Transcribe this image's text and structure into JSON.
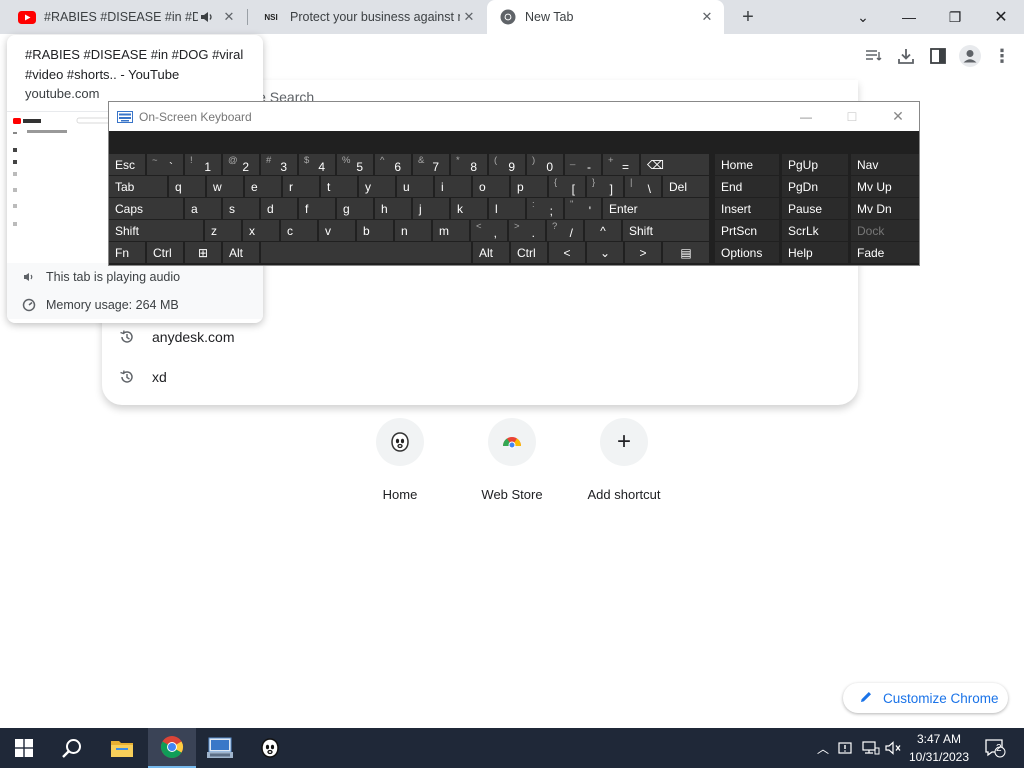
{
  "browser": {
    "tabs": [
      {
        "title": "#RABIES #DISEASE #in #DOG",
        "icon": "youtube-icon",
        "audio_icon": "speaker-icon"
      },
      {
        "title": "Protect your business against ne",
        "icon": "nsi-favicon",
        "favicon_text": "NSI"
      },
      {
        "title": "New Tab",
        "icon": "chrome-icon"
      }
    ],
    "new_tab_label": "+",
    "window_controls": {
      "tab_search": "⌄",
      "minimize": "—",
      "maximize": "❐",
      "close": "✕"
    }
  },
  "hover_card": {
    "title": "#RABIES #DISEASE #in #DOG #viral #video #shorts.. - YouTube",
    "domain": "youtube.com",
    "audio_status": "This tab is playing audio",
    "memory_usage": "Memory usage: 264 MB"
  },
  "new_tab_page": {
    "search_partial": "le Search",
    "history": [
      {
        "text": "anydesk.com",
        "icon": "history-icon"
      },
      {
        "text": "xd",
        "icon": "history-icon"
      }
    ],
    "shortcuts": [
      {
        "label": "Home",
        "icon": "ghost-face-icon"
      },
      {
        "label": "Web Store",
        "icon": "chrome-web-store-icon"
      },
      {
        "label": "Add shortcut",
        "icon": "plus-icon",
        "glyph": "+"
      }
    ],
    "customize_label": "Customize Chrome"
  },
  "osk": {
    "title": "On-Screen Keyboard",
    "controls": {
      "minimize": "—",
      "maximize": "☐",
      "close": "✕"
    },
    "rows": [
      [
        {
          "m": "Esc"
        },
        {
          "s": "~",
          "m": "`"
        },
        {
          "s": "!",
          "m": "1"
        },
        {
          "s": "@",
          "m": "2"
        },
        {
          "s": "#",
          "m": "3"
        },
        {
          "s": "$",
          "m": "4"
        },
        {
          "s": "%",
          "m": "5"
        },
        {
          "s": "^",
          "m": "6"
        },
        {
          "s": "&",
          "m": "7"
        },
        {
          "s": "*",
          "m": "8"
        },
        {
          "s": "(",
          "m": "9"
        },
        {
          "s": ")",
          "m": "0"
        },
        {
          "s": "_",
          "m": "-"
        },
        {
          "s": "+",
          "m": "="
        },
        {
          "m": "⌫"
        }
      ],
      [
        {
          "m": "Tab"
        },
        {
          "m": "q"
        },
        {
          "m": "w"
        },
        {
          "m": "e"
        },
        {
          "m": "r"
        },
        {
          "m": "t"
        },
        {
          "m": "y"
        },
        {
          "m": "u"
        },
        {
          "m": "i"
        },
        {
          "m": "o"
        },
        {
          "m": "p"
        },
        {
          "s": "{",
          "m": "["
        },
        {
          "s": "}",
          "m": "]"
        },
        {
          "s": "|",
          "m": "\\"
        },
        {
          "m": "Del"
        }
      ],
      [
        {
          "m": "Caps"
        },
        {
          "m": "a"
        },
        {
          "m": "s"
        },
        {
          "m": "d"
        },
        {
          "m": "f"
        },
        {
          "m": "g"
        },
        {
          "m": "h"
        },
        {
          "m": "j"
        },
        {
          "m": "k"
        },
        {
          "m": "l"
        },
        {
          "s": ":",
          "m": ";"
        },
        {
          "s": "\"",
          "m": "'"
        },
        {
          "m": "Enter"
        }
      ],
      [
        {
          "m": "Shift"
        },
        {
          "m": "z"
        },
        {
          "m": "x"
        },
        {
          "m": "c"
        },
        {
          "m": "v"
        },
        {
          "m": "b"
        },
        {
          "m": "n"
        },
        {
          "m": "m"
        },
        {
          "s": "<",
          "m": ","
        },
        {
          "s": ">",
          "m": "."
        },
        {
          "s": "?",
          "m": "/"
        },
        {
          "m": "^"
        },
        {
          "m": "Shift"
        }
      ],
      [
        {
          "m": "Fn"
        },
        {
          "m": "Ctrl"
        },
        {
          "m": "⊞",
          "icon": "windows-key-icon"
        },
        {
          "m": "Alt"
        },
        {
          "m": ""
        },
        {
          "m": "Alt"
        },
        {
          "m": "Ctrl"
        },
        {
          "m": "<"
        },
        {
          "m": "⌄"
        },
        {
          "m": ">"
        },
        {
          "m": "▤",
          "icon": "menu-key-icon"
        }
      ]
    ],
    "nav_keys": [
      [
        "Home",
        "PgUp",
        "Nav"
      ],
      [
        "End",
        "PgDn",
        "Mv Up"
      ],
      [
        "Insert",
        "Pause",
        "Mv Dn"
      ],
      [
        "PrtScn",
        "ScrLk",
        "Dock"
      ],
      [
        "Options",
        "Help",
        "Fade"
      ]
    ]
  },
  "taskbar": {
    "items": [
      {
        "name": "start-button",
        "icon": "windows-logo-icon"
      },
      {
        "name": "search-button",
        "icon": "search-icon"
      },
      {
        "name": "file-explorer-button",
        "icon": "folder-icon"
      },
      {
        "name": "chrome-taskbar-button",
        "icon": "chrome-icon"
      },
      {
        "name": "on-screen-keyboard-taskbar-button",
        "icon": "keyboard-icon"
      },
      {
        "name": "ghost-app-taskbar-button",
        "icon": "ghost-face-icon"
      }
    ],
    "time": "3:47 AM",
    "date": "10/31/2023",
    "notification_count": "2"
  }
}
